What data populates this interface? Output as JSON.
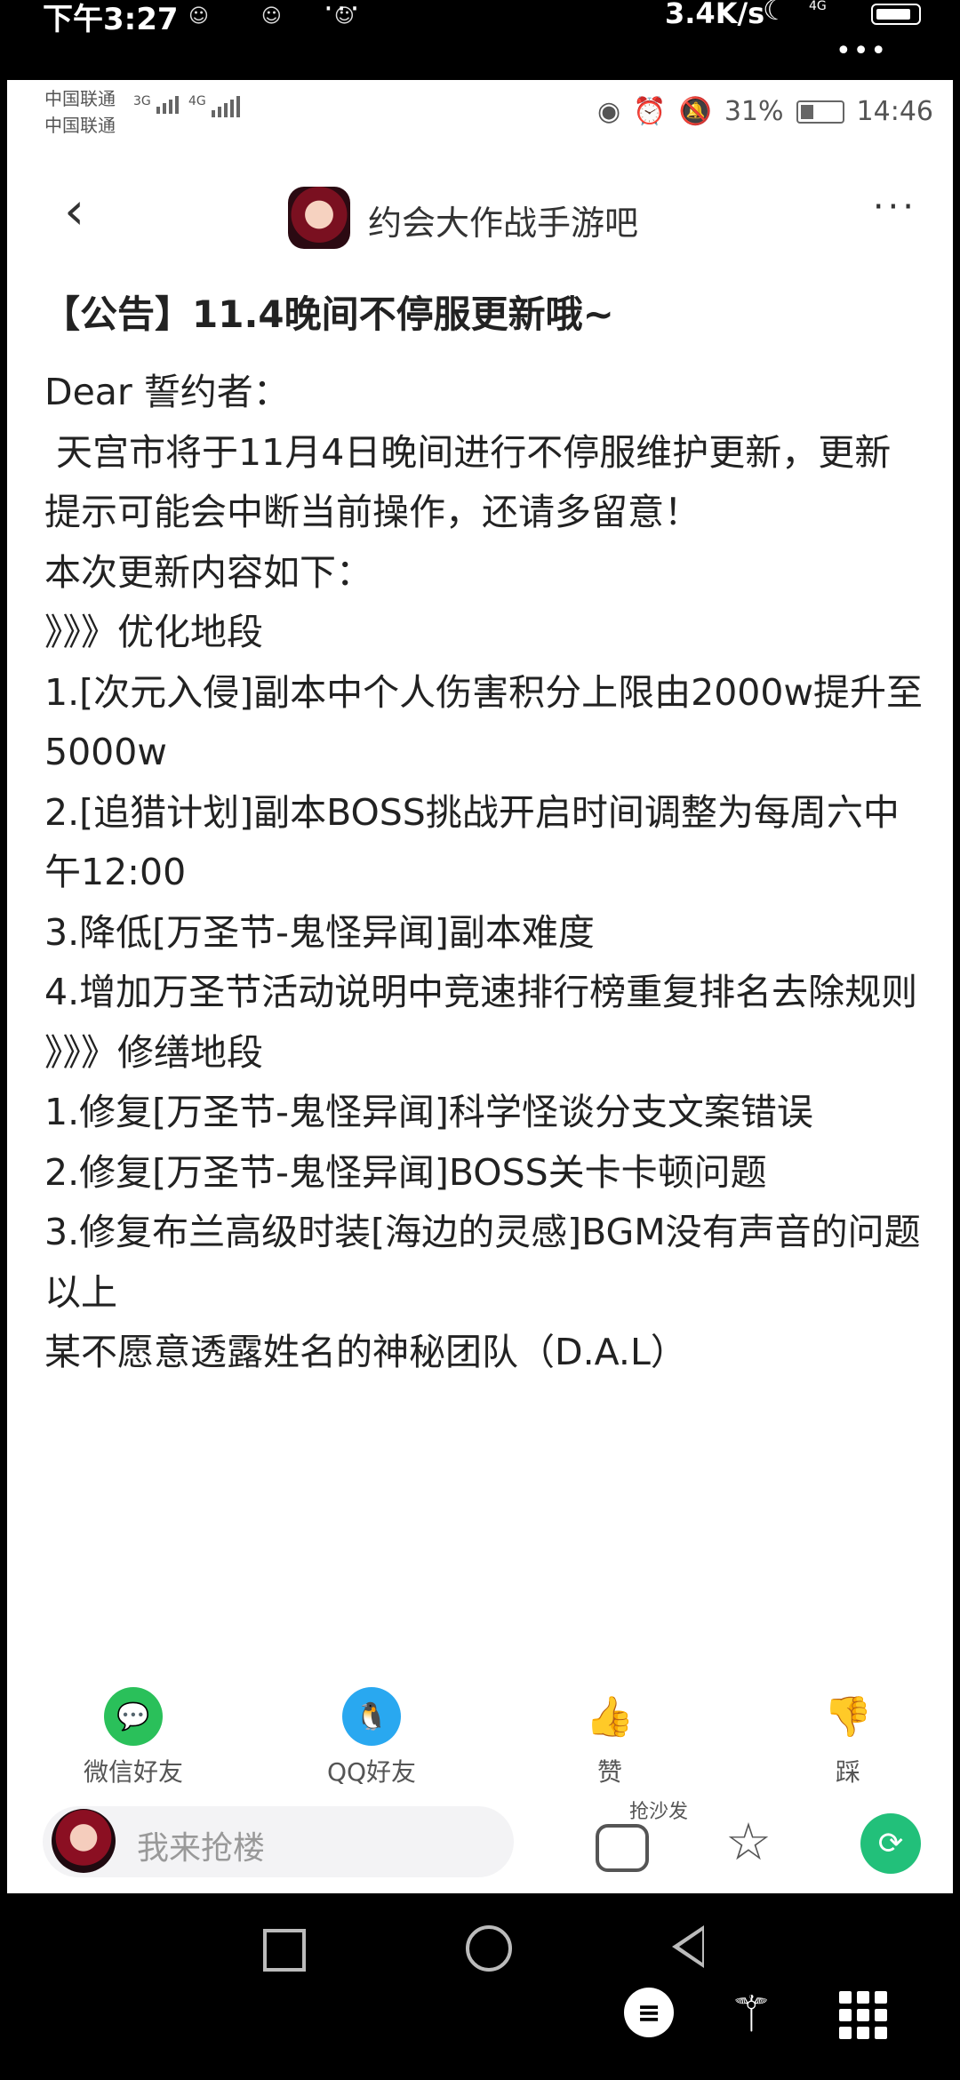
{
  "outer_status": {
    "time": "下午3:27",
    "notif_icons": "☺ ☺ ☺",
    "more": "···",
    "speed": "3.4K/s",
    "network": "4G",
    "overflow": "•••"
  },
  "inner_status": {
    "carrier1": "中国联通",
    "carrier2": "中国联通",
    "net1": "3G",
    "net2": "4G",
    "battery": "31%",
    "time": "14:46"
  },
  "nav": {
    "back": "‹",
    "forum_title": "约会大作战手游吧",
    "more": "···"
  },
  "post": {
    "title": "【公告】11.4晚间不停服更新哦~",
    "lines": [
      "Dear 誓约者：",
      " 天宫市将于11月4日晚间进行不停服维护更新，更新提示可能会中断当前操作，还请多留意！",
      "本次更新内容如下：",
      "》》》优化地段",
      "1.[次元入侵]副本中个人伤害积分上限由2000w提升至5000w",
      "2.[追猎计划]副本BOSS挑战开启时间调整为每周六中午12:00",
      "3.降低[万圣节-鬼怪异闻]副本难度",
      "4.增加万圣节活动说明中竞速排行榜重复排名去除规则",
      "》》》修缮地段",
      "1.修复[万圣节-鬼怪异闻]科学怪谈分支文案错误",
      "2.修复[万圣节-鬼怪异闻]BOSS关卡卡顿问题",
      "3.修复布兰高级时装[海边的灵感]BGM没有声音的问题",
      "以上",
      "某不愿意透露姓名的神秘团队（D.A.L）"
    ]
  },
  "share": {
    "wechat": "微信好友",
    "qq": "QQ好友",
    "like": "赞",
    "dislike": "踩"
  },
  "bottom": {
    "comment_placeholder": "我来抢楼",
    "sofa_label": "抢沙发"
  },
  "colors": {
    "wechat": "#2ac05a",
    "qq": "#29a8f0",
    "share_green": "#22c07a"
  }
}
